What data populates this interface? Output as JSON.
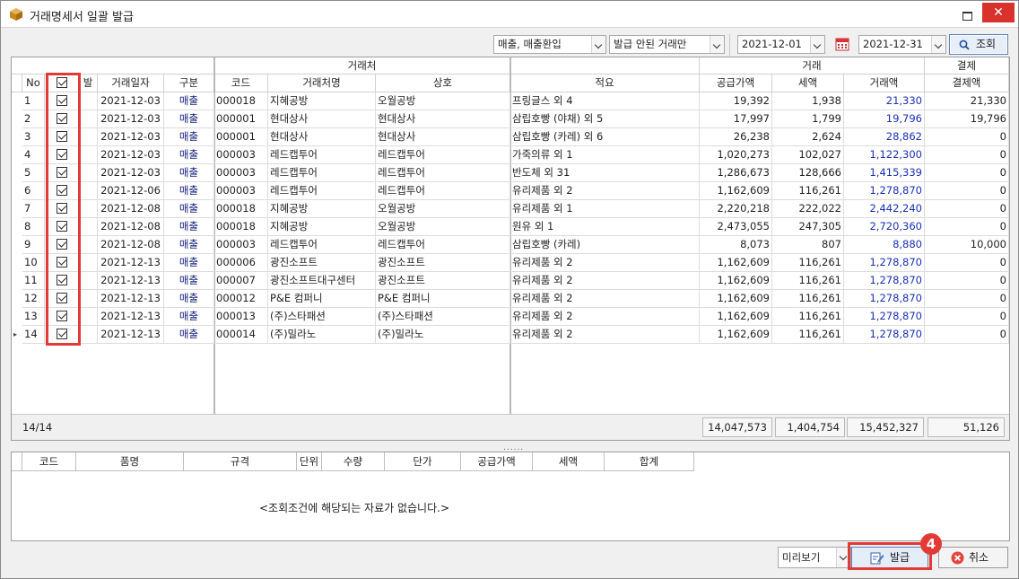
{
  "window": {
    "title": "거래명세서 일괄 발급",
    "close_glyph": "✕"
  },
  "toolbar": {
    "filter_type": "매출, 매출환입",
    "filter_issue": "발급 안된 거래만",
    "date_from": "2021-12-01",
    "date_to": "2021-12-31",
    "search_label": "조회"
  },
  "grid": {
    "group_headers": {
      "client": "거래처",
      "trade": "거래",
      "payment": "결제"
    },
    "headers": {
      "no": "No",
      "issued": "발",
      "date": "거래일자",
      "type": "구분",
      "code": "코드",
      "client_name": "거래처명",
      "company": "상호",
      "summary": "적요",
      "supply": "공급가액",
      "tax": "세액",
      "amount": "거래액",
      "paid": "결제액"
    },
    "rows": [
      {
        "no": "1",
        "date": "2021-12-03",
        "type": "매출",
        "code": "000018",
        "client": "지혜공방",
        "company": "오월공방",
        "summary": "프링글스 외 4",
        "supply": "19,392",
        "tax": "1,938",
        "amount": "21,330",
        "paid": "21,330"
      },
      {
        "no": "2",
        "date": "2021-12-03",
        "type": "매출",
        "code": "000001",
        "client": "현대상사",
        "company": "현대상사",
        "summary": "삼립호빵 (야채) 외 5",
        "supply": "17,997",
        "tax": "1,799",
        "amount": "19,796",
        "paid": "19,796"
      },
      {
        "no": "3",
        "date": "2021-12-03",
        "type": "매출",
        "code": "000001",
        "client": "현대상사",
        "company": "현대상사",
        "summary": "삼립호빵 (카레) 외 6",
        "supply": "26,238",
        "tax": "2,624",
        "amount": "28,862",
        "paid": "0"
      },
      {
        "no": "4",
        "date": "2021-12-03",
        "type": "매출",
        "code": "000003",
        "client": "레드캡투어",
        "company": "레드캡투어",
        "summary": "가죽의류 외 1",
        "supply": "1,020,273",
        "tax": "102,027",
        "amount": "1,122,300",
        "paid": "0"
      },
      {
        "no": "5",
        "date": "2021-12-03",
        "type": "매출",
        "code": "000003",
        "client": "레드캡투어",
        "company": "레드캡투어",
        "summary": "반도체 외 31",
        "supply": "1,286,673",
        "tax": "128,666",
        "amount": "1,415,339",
        "paid": "0"
      },
      {
        "no": "6",
        "date": "2021-12-06",
        "type": "매출",
        "code": "000003",
        "client": "레드캡투어",
        "company": "레드캡투어",
        "summary": "유리제품 외 2",
        "supply": "1,162,609",
        "tax": "116,261",
        "amount": "1,278,870",
        "paid": "0"
      },
      {
        "no": "7",
        "date": "2021-12-08",
        "type": "매출",
        "code": "000018",
        "client": "지혜공방",
        "company": "오월공방",
        "summary": "유리제품 외 1",
        "supply": "2,220,218",
        "tax": "222,022",
        "amount": "2,442,240",
        "paid": "0"
      },
      {
        "no": "8",
        "date": "2021-12-08",
        "type": "매출",
        "code": "000018",
        "client": "지혜공방",
        "company": "오월공방",
        "summary": "원유 외 1",
        "supply": "2,473,055",
        "tax": "247,305",
        "amount": "2,720,360",
        "paid": "0"
      },
      {
        "no": "9",
        "date": "2021-12-08",
        "type": "매출",
        "code": "000003",
        "client": "레드캡투어",
        "company": "레드캡투어",
        "summary": "삼립호빵 (카레)",
        "supply": "8,073",
        "tax": "807",
        "amount": "8,880",
        "paid": "10,000"
      },
      {
        "no": "10",
        "date": "2021-12-13",
        "type": "매출",
        "code": "000006",
        "client": "광진소프트",
        "company": "광진소프트",
        "summary": "유리제품 외 2",
        "supply": "1,162,609",
        "tax": "116,261",
        "amount": "1,278,870",
        "paid": "0"
      },
      {
        "no": "11",
        "date": "2021-12-13",
        "type": "매출",
        "code": "000007",
        "client": "광진소프트대구센터",
        "company": "광진소프트",
        "summary": "유리제품 외 2",
        "supply": "1,162,609",
        "tax": "116,261",
        "amount": "1,278,870",
        "paid": "0"
      },
      {
        "no": "12",
        "date": "2021-12-13",
        "type": "매출",
        "code": "000012",
        "client": "P&E 컴퍼니",
        "company": "P&E 컴퍼니",
        "summary": "유리제품 외 2",
        "supply": "1,162,609",
        "tax": "116,261",
        "amount": "1,278,870",
        "paid": "0"
      },
      {
        "no": "13",
        "date": "2021-12-13",
        "type": "매출",
        "code": "000013",
        "client": "(주)스타패션",
        "company": "(주)스타패션",
        "summary": "유리제품 외 2",
        "supply": "1,162,609",
        "tax": "116,261",
        "amount": "1,278,870",
        "paid": "0"
      },
      {
        "no": "14",
        "date": "2021-12-13",
        "type": "매출",
        "code": "000014",
        "client": "(주)밀라노",
        "company": "(주)밀라노",
        "summary": "유리제품 외 2",
        "supply": "1,162,609",
        "tax": "116,261",
        "amount": "1,278,870",
        "paid": "0"
      }
    ],
    "row_indicator_glyph": "▸",
    "summary": {
      "count": "14/14",
      "supply": "14,047,573",
      "tax": "1,404,754",
      "amount": "15,452,327",
      "paid": "51,126"
    }
  },
  "splitter_glyph": "......",
  "detail": {
    "headers": [
      "코드",
      "품명",
      "규격",
      "단위",
      "수량",
      "단가",
      "공급가액",
      "세액",
      "합계"
    ],
    "empty_message": "<조회조건에 해당되는 자료가 없습니다.>"
  },
  "bottom": {
    "preview": "미리보기",
    "issue_label": "발급",
    "cancel_label": "취소",
    "step_badge": "4"
  },
  "colors": {
    "highlight": "#e23b36",
    "amount_text": "#1a2fb3",
    "type_text": "#17217d"
  }
}
